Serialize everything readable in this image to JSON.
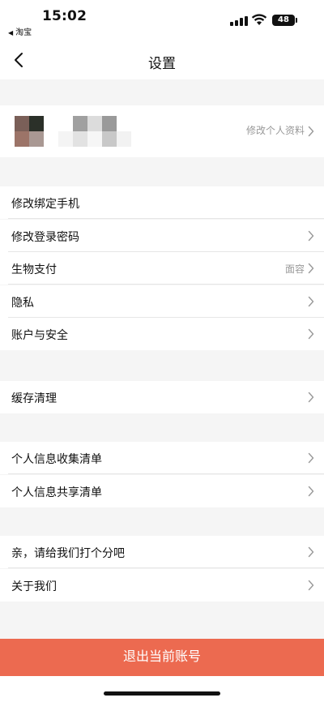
{
  "status_bar": {
    "time": "15:02",
    "back_app": "淘宝",
    "battery": "48"
  },
  "nav": {
    "title": "设置",
    "back_icon": "chevron-left-icon"
  },
  "profile": {
    "edit_label": "修改个人资料"
  },
  "groups": [
    {
      "rows": [
        {
          "label": "修改绑定手机",
          "value": "",
          "chevron": false
        },
        {
          "label": "修改登录密码",
          "value": "",
          "chevron": true
        },
        {
          "label": "生物支付",
          "value": "面容",
          "chevron": true
        },
        {
          "label": "隐私",
          "value": "",
          "chevron": true
        },
        {
          "label": "账户与安全",
          "value": "",
          "chevron": true
        }
      ]
    },
    {
      "rows": [
        {
          "label": "缓存清理",
          "value": "",
          "chevron": true
        }
      ]
    },
    {
      "rows": [
        {
          "label": "个人信息收集清单",
          "value": "",
          "chevron": true
        },
        {
          "label": "个人信息共享清单",
          "value": "",
          "chevron": true
        }
      ]
    },
    {
      "rows": [
        {
          "label": "亲，请给我们打个分吧",
          "value": "",
          "chevron": true
        },
        {
          "label": "关于我们",
          "value": "",
          "chevron": true
        }
      ]
    }
  ],
  "logout": {
    "label": "退出当前账号"
  },
  "colors": {
    "logout_bg": "#ec6a50",
    "page_bg": "#f5f5f5",
    "secondary_text": "#999999"
  }
}
